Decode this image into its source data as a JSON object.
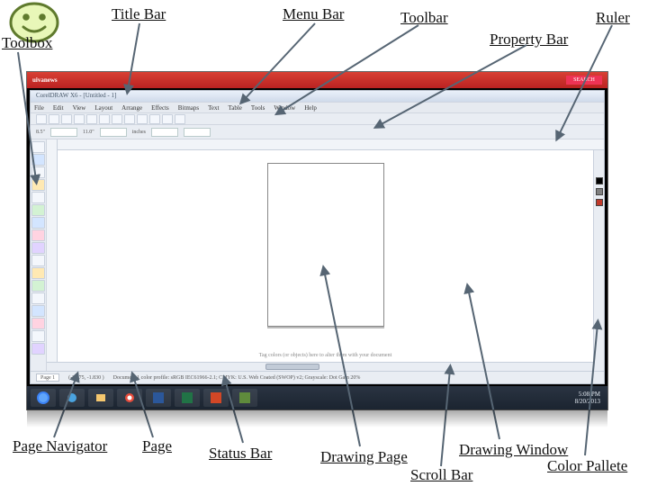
{
  "labels": {
    "title_bar": "Title Bar",
    "menu_bar": "Menu Bar",
    "toolbar": "Toolbar",
    "ruler": "Ruler",
    "property_bar": "Property Bar",
    "toolbox": "Toolbox",
    "page_navigator": "Page Navigator",
    "page": "Page",
    "status_bar": "Status Bar",
    "drawing_page": "Drawing Page",
    "drawing_window": "Drawing Window",
    "scroll_bar": "Scroll Bar",
    "color_pallete": "Color Pallete"
  },
  "app": {
    "title": "CorelDRAW X6 - [Untitled - 1]",
    "menu": [
      "File",
      "Edit",
      "View",
      "Layout",
      "Arrange",
      "Effects",
      "Bitmaps",
      "Text",
      "Table",
      "Tools",
      "Window",
      "Help"
    ],
    "property": {
      "coord_x": "8.5\"",
      "coord_y": "11.0\"",
      "units": "inches"
    },
    "footer": {
      "cursor": "(-3.575, -1.830 )",
      "status": "Document 1 color profile: sRGB IEC61966-2.1; CMYK: U.S. Web Coated (SWOP) v2; Grayscale: Dot Gain 20%",
      "page_tab": "Page 1",
      "hint": "Tag colors (or objects) here to alter them with your document"
    }
  },
  "browser": {
    "logo": "uivanews",
    "search": "SEARCH"
  },
  "taskbar": {
    "time": "5:08 PM",
    "date": "8/20/2013"
  },
  "palette_colors": [
    "#000000",
    "#808080",
    "#c0392b"
  ]
}
